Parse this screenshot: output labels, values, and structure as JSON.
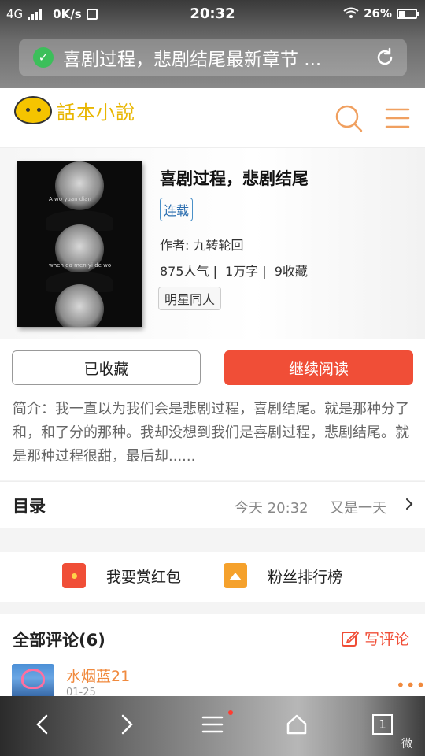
{
  "status_bar": {
    "network": "4G",
    "speed": "0K/s",
    "time": "20:32",
    "battery": "26%"
  },
  "browser": {
    "url_title": "喜剧过程，悲剧结尾最新章节 ..."
  },
  "site": {
    "logo_text": "話本小說",
    "icons": [
      "search-icon",
      "menu-icon"
    ],
    "accent_color": "#f0a060"
  },
  "book": {
    "title": "喜剧过程，悲剧结尾",
    "status_badge": "连载",
    "author": "作者: 九转轮回",
    "popularity": "875人气 |",
    "words": "1万字 |",
    "favorites": "9收藏",
    "tag": "明星同人",
    "cover_captions": [
      "A wo yuan dian",
      "when da men yi de wo"
    ]
  },
  "actions": {
    "favorited_label": "已收藏",
    "continue_label": "继续阅读",
    "primary_color": "#f04e37"
  },
  "intro": "简介：我一直以为我们会是悲剧过程，喜剧结尾。就是那种分了和，和了分的那种。我却没想到我们是喜剧过程，悲剧结尾。就是那种过程很甜，最后却......",
  "toc": {
    "label": "目录",
    "update_time": "今天 20:32",
    "latest_chapter": "又是一天"
  },
  "rewards": {
    "red_packet_label": "我要赏红包",
    "fan_rank_label": "粉丝排行榜"
  },
  "comments": {
    "header": "全部评论(6)",
    "write_label": "写评论",
    "items": [
      {
        "user": "水烟蓝21",
        "date": "01-25"
      }
    ]
  },
  "bottom_bar": {
    "icons": [
      "back-icon",
      "forward-icon",
      "menu-icon",
      "home-icon",
      "tabs-icon"
    ],
    "tabs_count": "1",
    "watermark": "微"
  }
}
